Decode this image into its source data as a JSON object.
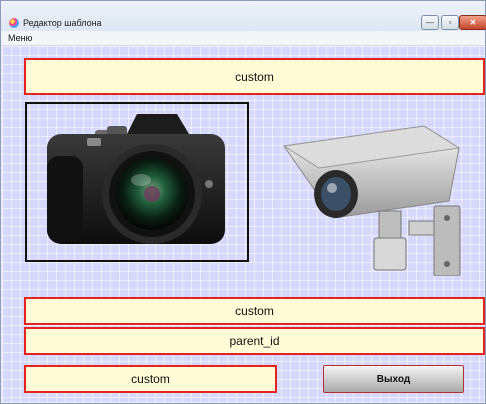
{
  "window": {
    "title": "Редактор шаблона",
    "controls": {
      "minimize": "—",
      "maximize": "▫",
      "close": "✕"
    }
  },
  "menu": {
    "items": [
      "Меню"
    ]
  },
  "fields": {
    "top": "custom",
    "middle": "custom",
    "parent": "parent_id",
    "bottom_left": "custom"
  },
  "buttons": {
    "exit": "Выход"
  },
  "colors": {
    "field_bg": "#fffbd6",
    "field_border": "#e32222",
    "client_bg": "#d6d9fb"
  }
}
